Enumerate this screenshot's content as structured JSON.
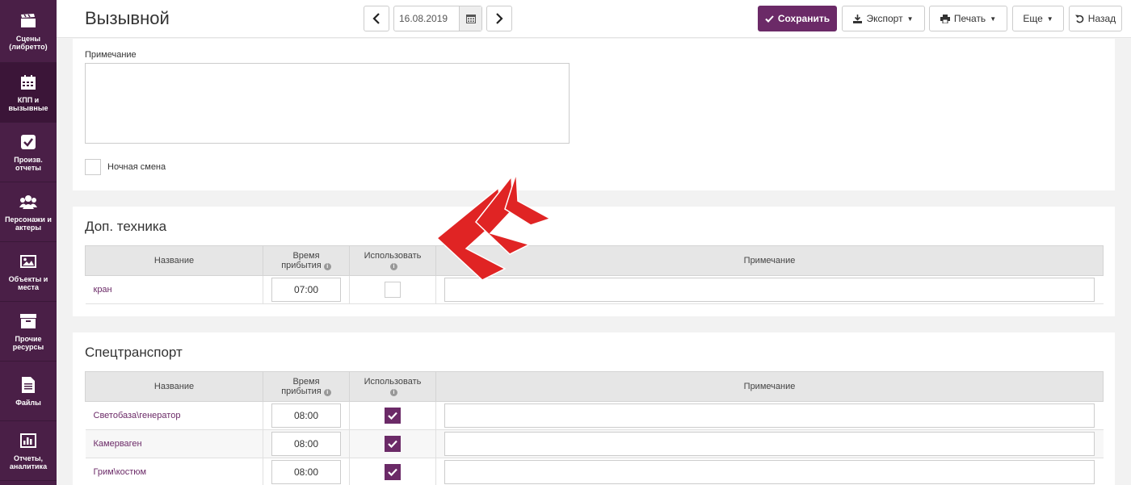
{
  "sidebar": {
    "items": [
      {
        "label": "Сцены\n(либретто)",
        "icon": "clapperboard-icon",
        "active": false
      },
      {
        "label": "КПП и\nвызывные",
        "icon": "calendar-icon",
        "active": true
      },
      {
        "label": "Произв.\nотчеты",
        "icon": "checkbox-icon",
        "active": false
      },
      {
        "label": "Персонажи и\nактеры",
        "icon": "users-icon",
        "active": false
      },
      {
        "label": "Объекты и\nместа",
        "icon": "image-icon",
        "active": false
      },
      {
        "label": "Прочие\nресурсы",
        "icon": "archive-icon",
        "active": false
      },
      {
        "label": "Файлы",
        "icon": "file-icon",
        "active": false
      },
      {
        "label": "Отчеты,\nаналитика",
        "icon": "bar-chart-icon",
        "active": false
      }
    ]
  },
  "header": {
    "title": "Вызывной",
    "date": "16.08.2019",
    "buttons": {
      "save": "Сохранить",
      "export": "Экспорт",
      "print": "Печать",
      "more": "Еще",
      "back": "Назад"
    }
  },
  "general": {
    "note_label": "Примечание",
    "note_value": "",
    "night_shift_label": "Ночная смена",
    "night_shift": false
  },
  "columns": {
    "name": "Название",
    "arrival_line1": "Время",
    "arrival_line2": "прибытия",
    "use": "Использовать",
    "note": "Примечание"
  },
  "equipment": {
    "title": "Доп. техника",
    "rows": [
      {
        "name": "кран",
        "time": "07:00",
        "use": false,
        "note": ""
      }
    ]
  },
  "transport": {
    "title": "Спецтранспорт",
    "rows": [
      {
        "name": "Светобаза\\генератор",
        "time": "08:00",
        "use": true,
        "note": ""
      },
      {
        "name": "Камерваген",
        "time": "08:00",
        "use": true,
        "note": ""
      },
      {
        "name": "Грим\\костюм",
        "time": "08:00",
        "use": true,
        "note": ""
      }
    ]
  },
  "colors": {
    "accent": "#6b2a67",
    "sidebar": "#4a1f47",
    "annotation_arrow": "#e02424"
  }
}
